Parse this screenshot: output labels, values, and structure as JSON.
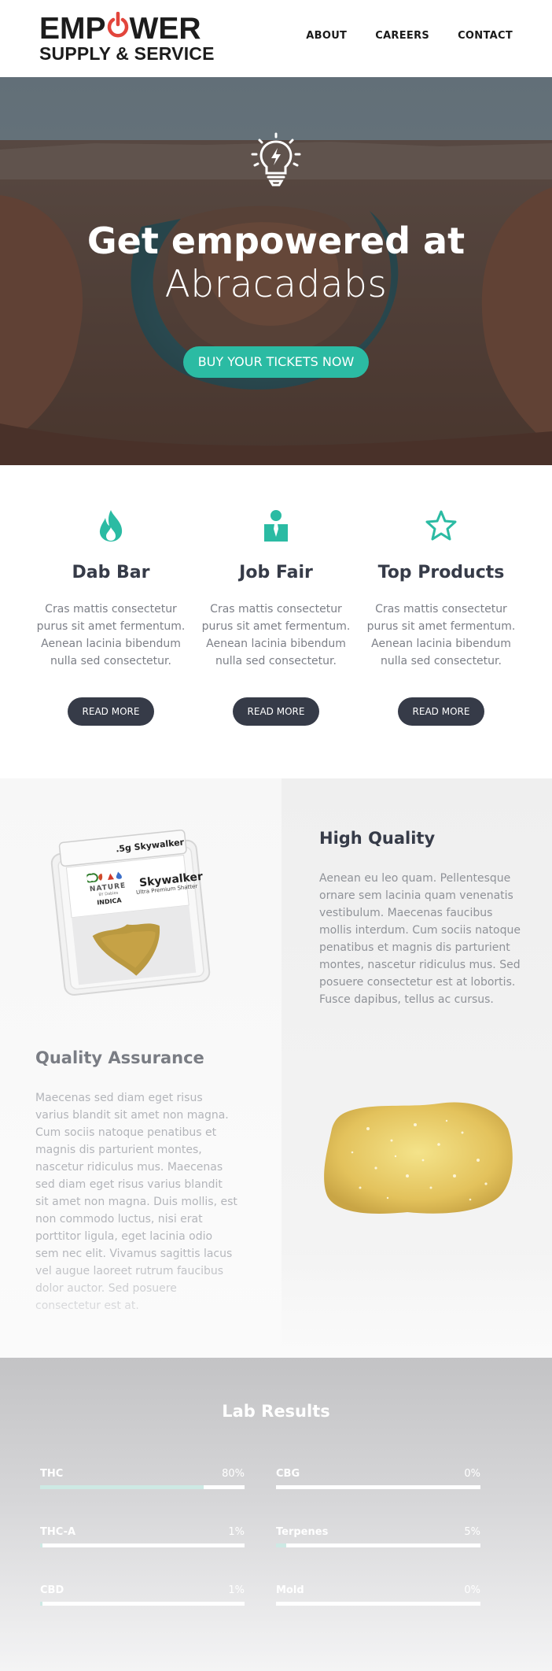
{
  "header": {
    "logo_line1_a": "EMP",
    "logo_line1_b": "WER",
    "logo_line2": "SUPPLY & SERVICE",
    "nav": [
      "ABOUT",
      "CAREERS",
      "CONTACT"
    ]
  },
  "hero": {
    "title": "Get empowered at",
    "subtitle": "Abracadabs",
    "button": "BUY YOUR TICKETS NOW",
    "icon": "lightbulb-icon"
  },
  "features": [
    {
      "icon": "flame-icon",
      "title": "Dab Bar",
      "text": "Cras mattis consectetur purus sit amet fermentum. Aenean lacinia bibendum nulla sed consectetur.",
      "button": "READ MORE"
    },
    {
      "icon": "person-icon",
      "title": "Job Fair",
      "text": "Cras mattis consectetur purus sit amet fermentum. Aenean lacinia bibendum nulla sed consectetur.",
      "button": "READ MORE"
    },
    {
      "icon": "star-icon",
      "title": "Top Products",
      "text": "Cras mattis consectetur purus sit amet fermentum. Aenean lacinia bibendum nulla sed consectetur.",
      "button": "READ MORE"
    }
  ],
  "quality": {
    "high_title": "High Quality",
    "high_text": "Aenean eu leo quam. Pellentesque ornare sem lacinia quam venenatis vestibulum. Maecenas faucibus mollis interdum. Cum sociis natoque penatibus et magnis dis parturient montes, nascetur ridiculus mus. Sed posuere consectetur est at lobortis. Fusce dapibus, tellus ac cursus.",
    "assurance_title": "Quality Assurance",
    "assurance_text": "Maecenas sed diam eget risus varius blandit sit amet non magna. Cum sociis natoque penatibus et magnis dis parturient montes, nascetur ridiculus mus. Maecenas sed diam eget risus varius blandit sit amet non magna. Duis mollis, est non commodo luctus, nisi erat porttitor ligula, eget lacinia odio sem nec elit. Vivamus sagittis lacus vel augue laoreet rutrum faucibus dolor auctor. Sed posuere consectetur est at.",
    "product": {
      "weight": ".5g Skywalker",
      "brand": "NATURE",
      "brand_sub": "BY Dabies",
      "strain_type": "INDICA",
      "name": "Skywalker",
      "desc": "Ultra Premium Shatter"
    }
  },
  "lab": {
    "title": "Lab Results",
    "results": [
      {
        "label": "THC",
        "value": "80%",
        "level": 0.8
      },
      {
        "label": "CBG",
        "value": "0%",
        "level": 0
      },
      {
        "label": "THC-A",
        "value": "1%",
        "level": 0.01
      },
      {
        "label": "Terpenes",
        "value": "5%",
        "level": 0.05
      },
      {
        "label": "CBD",
        "value": "1%",
        "level": 0.01
      },
      {
        "label": "Mold",
        "value": "0%",
        "level": 0
      }
    ]
  },
  "colors": {
    "accent": "#2bbba3",
    "dark": "#363b48",
    "logo_red": "#e2453c"
  }
}
